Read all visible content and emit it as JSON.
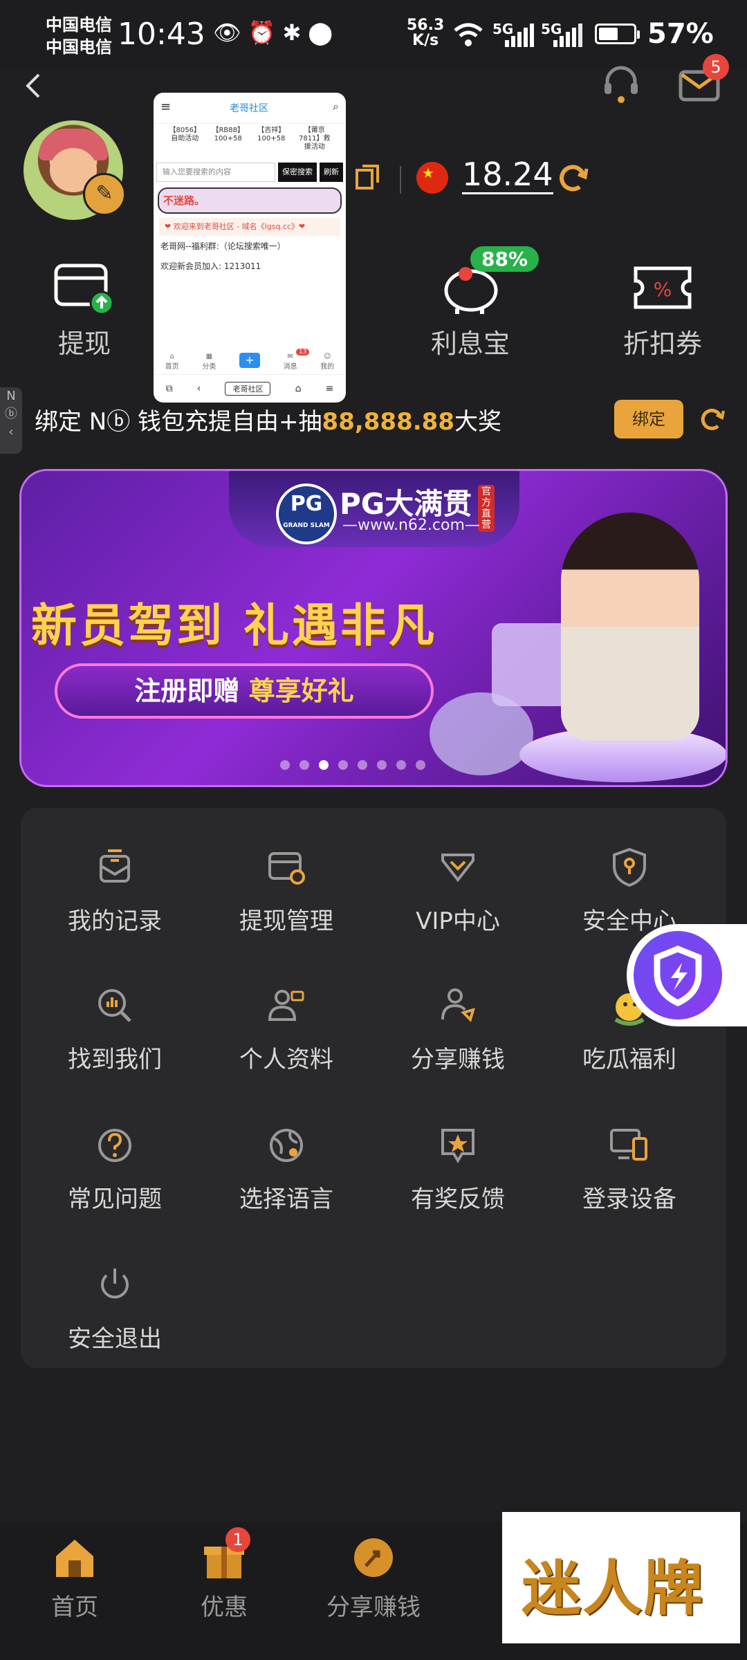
{
  "status": {
    "carrier1": "中国电信",
    "carrier2": "中国电信",
    "time": "10:43",
    "net_speed_value": "56.3",
    "net_speed_unit": "K/s",
    "sig1": "5G",
    "sig2": "5G",
    "battery_level": 0.57,
    "battery_pct": "57%"
  },
  "header": {
    "mail_badge": "5",
    "balance": "18.24"
  },
  "quick_actions": [
    {
      "label": "提现"
    },
    {
      "label": "利息宝",
      "badge": "88%"
    },
    {
      "label": "折扣券"
    }
  ],
  "promo": {
    "text_prefix": "绑定 N",
    "text_mid": " 钱包充提自由+抽",
    "amount": "88,888.88",
    "text_suffix": "大奖",
    "bind_label": "绑定",
    "side_tab": "N"
  },
  "banner": {
    "logo": "PG",
    "logo_sub": "GRAND SLAM",
    "title": "PG大满贯",
    "tag": "官方直营",
    "url": "—www.n62.com—",
    "slogan": "新员驾到 礼遇非凡",
    "pill_a": "注册即赠 ",
    "pill_b": "尊享好礼",
    "dots_total": 8,
    "dots_active": 2
  },
  "menu": [
    {
      "label": "我的记录",
      "icon": "record-icon"
    },
    {
      "label": "提现管理",
      "icon": "wallet-gear-icon"
    },
    {
      "label": "VIP中心",
      "icon": "vip-diamond-icon"
    },
    {
      "label": "安全中心",
      "icon": "shield-key-icon"
    },
    {
      "label": "找到我们",
      "icon": "search-chart-icon"
    },
    {
      "label": "个人资料",
      "icon": "profile-card-icon"
    },
    {
      "label": "分享赚钱",
      "icon": "share-user-icon"
    },
    {
      "label": "吃瓜福利",
      "icon": "emoji-melon-icon"
    },
    {
      "label": "常见问题",
      "icon": "question-icon"
    },
    {
      "label": "选择语言",
      "icon": "globe-icon"
    },
    {
      "label": "有奖反馈",
      "icon": "star-chat-icon"
    },
    {
      "label": "登录设备",
      "icon": "devices-icon"
    },
    {
      "label": "安全退出",
      "icon": "power-icon"
    }
  ],
  "tabs": [
    {
      "label": "首页",
      "icon": "home-icon"
    },
    {
      "label": "优惠",
      "icon": "gift-icon",
      "badge": "1"
    },
    {
      "label": "分享赚钱",
      "icon": "share-coin-icon"
    }
  ],
  "watermark": "迷人牌",
  "mini_browser": {
    "site": "老哥社区",
    "grid": [
      "【8056】自助活动",
      "【RB88】100+58",
      "【吉祥】100+58",
      "【莆京7811】救援活动"
    ],
    "search_placeholder": "输入您要搜索的内容",
    "search_btn": "保密搜索",
    "refresh_btn": "刷新",
    "red_text": "不迷路。",
    "notice": "❤ 欢迎来到老哥社区 - 域名《lgsq.cc》❤",
    "line1": "老哥网--福利群:（论坛搜索唯一）",
    "line2": "欢迎新会员加入:  1213011",
    "nav": [
      "首页",
      "分类",
      "消息",
      "我的"
    ],
    "nav_badge": "13",
    "url": "老哥社区"
  }
}
